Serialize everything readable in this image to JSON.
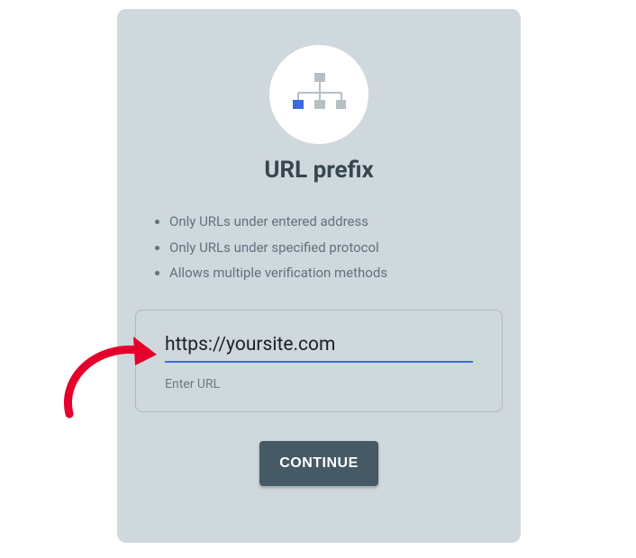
{
  "title": "URL prefix",
  "bullets": [
    "Only URLs under entered address",
    "Only URLs under specified protocol",
    "Allows multiple verification methods"
  ],
  "input": {
    "value": "https://yoursite.com",
    "helper": "Enter URL"
  },
  "button": "CONTINUE",
  "colors": {
    "accent": "#3a6ae0",
    "buttonBg": "#455a64",
    "cardBg": "#cfd8dc"
  }
}
